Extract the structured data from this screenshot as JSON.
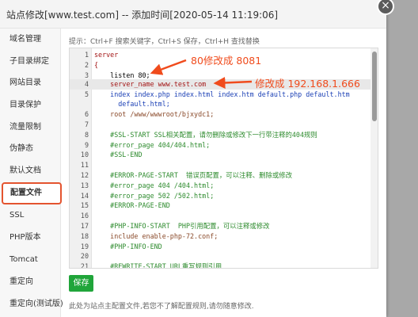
{
  "dialog": {
    "title": "站点修改[www.test.com] -- 添加时间[2020-05-14 11:19:06]",
    "close_glyph": "×"
  },
  "sidebar": {
    "items": [
      {
        "label": "域名管理"
      },
      {
        "label": "子目录绑定"
      },
      {
        "label": "网站目录"
      },
      {
        "label": "目录保护"
      },
      {
        "label": "流量限制"
      },
      {
        "label": "伪静态"
      },
      {
        "label": "默认文档"
      },
      {
        "label": "配置文件",
        "active": true
      },
      {
        "label": "SSL"
      },
      {
        "label": "PHP版本"
      },
      {
        "label": "Tomcat"
      },
      {
        "label": "重定向"
      },
      {
        "label": "重定向(测试版)"
      }
    ]
  },
  "editor": {
    "hint": "提示：Ctrl+F 搜索关键字，Ctrl+S 保存，Ctrl+H 查找替换",
    "active_line": 4,
    "lines": [
      {
        "n": "1",
        "text": "server"
      },
      {
        "n": "2",
        "text": "{"
      },
      {
        "n": "3",
        "text": "    listen 80;"
      },
      {
        "n": "4",
        "text": "    server_name www.test.com"
      },
      {
        "n": "5",
        "text": "    index index.php index.html index.htm default.php default.htm"
      },
      {
        "n": "",
        "text": "      default.html;"
      },
      {
        "n": "6",
        "text": "    root /www/wwwroot/bjxydc1;"
      },
      {
        "n": "7",
        "text": ""
      },
      {
        "n": "8",
        "text": "    #SSL-START SSL相关配置，请勿删除或修改下一行带注释的404规则"
      },
      {
        "n": "9",
        "text": "    #error_page 404/404.html;"
      },
      {
        "n": "10",
        "text": "    #SSL-END"
      },
      {
        "n": "11",
        "text": ""
      },
      {
        "n": "12",
        "text": "    #ERROR-PAGE-START  错误页配置，可以注释、删除或修改"
      },
      {
        "n": "13",
        "text": "    #error_page 404 /404.html;"
      },
      {
        "n": "14",
        "text": "    #error_page 502 /502.html;"
      },
      {
        "n": "15",
        "text": "    #ERROR-PAGE-END"
      },
      {
        "n": "16",
        "text": ""
      },
      {
        "n": "17",
        "text": "    #PHP-INFO-START  PHP引用配置，可以注释或修改"
      },
      {
        "n": "18",
        "text": "    include enable-php-72.conf;"
      },
      {
        "n": "19",
        "text": "    #PHP-INFO-END"
      },
      {
        "n": "20",
        "text": ""
      },
      {
        "n": "21",
        "text": "    #REWRITE-START URL重写规则引用"
      }
    ]
  },
  "annotations": {
    "port_note": "80修改成 8081",
    "ip_note": "修改成 192.168.1.666",
    "color": "#f04b1c"
  },
  "actions": {
    "save_label": "保存"
  },
  "footnote": "此处为站点主配置文件,若您不了解配置规则,请勿随意修改."
}
